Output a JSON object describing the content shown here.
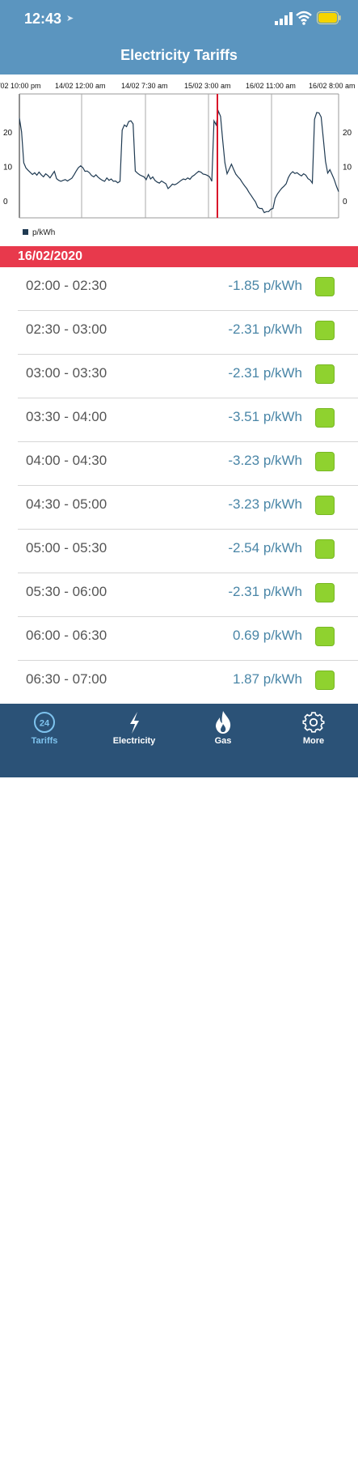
{
  "status": {
    "time": "12:43"
  },
  "header": {
    "title": "Electricity Tariffs"
  },
  "chart_data": {
    "type": "line",
    "top_tick_labels": [
      "/02 10:00 pm",
      "14/02 12:00 am",
      "14/02 7:30 am",
      "15/02 3:00 am",
      "16/02 11:00 am",
      "16/02 8:00 am"
    ],
    "y_ticks": [
      "20",
      "10",
      "0"
    ],
    "legend": [
      "p/kWh"
    ],
    "series": [
      {
        "name": "p/kWh",
        "color": "#1f3a52",
        "values": [
          24,
          20,
          11,
          9.5,
          8.8,
          8.2,
          7.6,
          8.1,
          7.4,
          8.3,
          7.5,
          6.9,
          7.8,
          7.3,
          6.6,
          7.6,
          8.5,
          6.4,
          5.9,
          5.6,
          5.9,
          6.1,
          5.7,
          6.1,
          6.5,
          7.5,
          8.6,
          9.6,
          10.1,
          9.6,
          8.5,
          8.6,
          8.1,
          7.3,
          6.9,
          7.5,
          6.8,
          6.3,
          5.9,
          5.6,
          6.6,
          5.9,
          6.3,
          5.6,
          5.7,
          5.2,
          5.6,
          20.5,
          22,
          21.5,
          23,
          23.2,
          22.3,
          8.6,
          8,
          7.5,
          7.2,
          6.9,
          6.1,
          7.6,
          6.3,
          6.9,
          5.9,
          5.4,
          5.1,
          5.7,
          5.3,
          4.9,
          3.5,
          4.1,
          4.8,
          4.6,
          4.9,
          5.4,
          5.9,
          6.3,
          6.1,
          6.6,
          6.2,
          7.0,
          7.4,
          8.0,
          8.5,
          8.3,
          7.7,
          7.6,
          7.3,
          6.9,
          5.6,
          23.2,
          22.0,
          26.0,
          24.5,
          17.5,
          11.0,
          7.8,
          9.2,
          10.6,
          9.1,
          7.7,
          6.9,
          6.2,
          5.2,
          4.3,
          3.5,
          2.4,
          1.5,
          0.5,
          -0.4,
          -1.9,
          -2.3,
          -2.3,
          -3.5,
          -3.2,
          -3.2,
          -2.5,
          -2.3,
          0.7,
          1.9,
          2.8,
          3.6,
          4.2,
          4.9,
          6.7,
          7.8,
          8.4,
          7.9,
          8.1,
          7.6,
          7.2,
          7.8,
          7.4,
          6.4,
          6.0,
          5.1,
          23.6,
          25.6,
          25.5,
          24.3,
          18.0,
          11.4,
          8.0,
          9.0,
          7.6,
          6.1,
          4.2,
          2.6
        ]
      }
    ],
    "ylim": [
      -5,
      31
    ],
    "current_time_marker": "16/02 02:00",
    "grid": true,
    "legend_position": "bottom-left"
  },
  "date_banner": "16/02/2020",
  "rows": [
    {
      "time": "02:00 - 02:30",
      "price": "-1.85 p/kWh"
    },
    {
      "time": "02:30 - 03:00",
      "price": "-2.31 p/kWh"
    },
    {
      "time": "03:00 - 03:30",
      "price": "-2.31 p/kWh"
    },
    {
      "time": "03:30 - 04:00",
      "price": "-3.51 p/kWh"
    },
    {
      "time": "04:00 - 04:30",
      "price": "-3.23 p/kWh"
    },
    {
      "time": "04:30 - 05:00",
      "price": "-3.23 p/kWh"
    },
    {
      "time": "05:00 - 05:30",
      "price": "-2.54 p/kWh"
    },
    {
      "time": "05:30 - 06:00",
      "price": "-2.31 p/kWh"
    },
    {
      "time": "06:00 - 06:30",
      "price": "0.69 p/kWh"
    },
    {
      "time": "06:30 - 07:00",
      "price": "1.87 p/kWh"
    }
  ],
  "tabs": [
    {
      "label": "Tariffs",
      "icon": "clock-24-icon",
      "active": true
    },
    {
      "label": "Electricity",
      "icon": "lightning-icon"
    },
    {
      "label": "Gas",
      "icon": "flame-icon"
    },
    {
      "label": "More",
      "icon": "gear-icon"
    }
  ],
  "colors": {
    "header": "#5b95bf",
    "date_banner": "#e8394c",
    "price_text": "#4a86a7",
    "indicator_green": "#8fd22f",
    "tab_bar": "#2b5277",
    "tab_active": "#7ec3ee",
    "marker_red": "#d9162a"
  }
}
